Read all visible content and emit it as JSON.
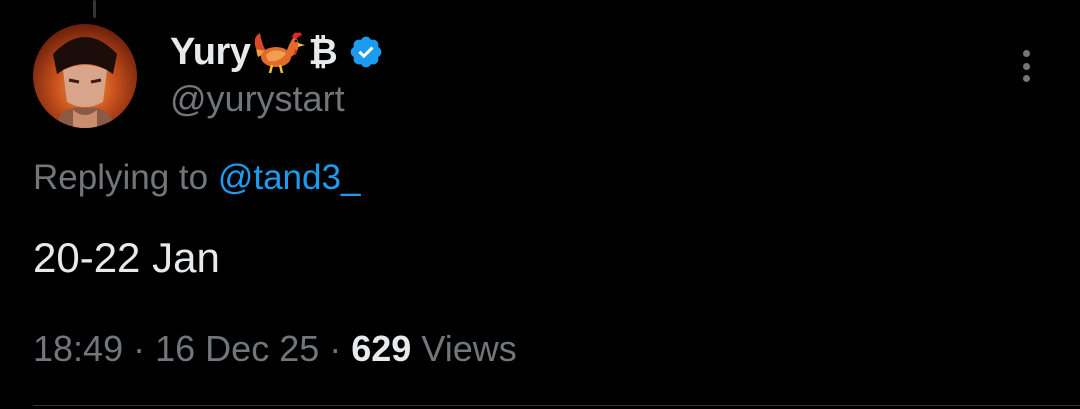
{
  "tweet": {
    "author": {
      "display_name": "Yury",
      "name_suffix": "₿",
      "name_emoji": "rooster-icon",
      "handle": "@yurystart",
      "verified": true,
      "verified_color": "#1d9bf0"
    },
    "reply": {
      "prefix": "Replying to ",
      "mention": "@tand3_"
    },
    "text": "20-22 Jan",
    "meta": {
      "time": "18:49",
      "separator": "·",
      "date": "16 Dec 25",
      "views_count": "629",
      "views_label": "Views"
    }
  },
  "colors": {
    "background": "#000000",
    "primary_text": "#e7e9ea",
    "secondary_text": "#71767b",
    "link": "#1d9bf0"
  }
}
